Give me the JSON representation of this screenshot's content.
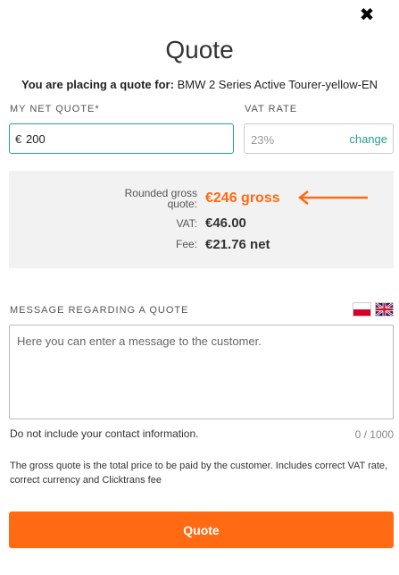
{
  "modal": {
    "title": "Quote",
    "close_icon": "close-icon",
    "subtitle_prefix": "You are placing a quote for:",
    "subtitle_product": "BMW 2 Series Active Tourer-yellow-EN"
  },
  "net_quote": {
    "label": "MY NET QUOTE*",
    "currency": "€",
    "value": "200"
  },
  "vat": {
    "label": "VAT RATE",
    "value": "23%",
    "change_label": "change"
  },
  "summary": {
    "gross_label": "Rounded gross quote:",
    "gross_value": "€246 gross",
    "vat_label": "VAT:",
    "vat_value": "€46.00",
    "fee_label": "Fee:",
    "fee_value": "€21.76 net",
    "accent_color": "#ff6a13"
  },
  "message": {
    "label": "MESSAGE REGARDING A QUOTE",
    "placeholder": "Here you can enter a message to the customer.",
    "hint": "Do not include your contact information.",
    "counter": "0 / 1000",
    "flags": [
      "flag-pl-icon",
      "flag-uk-icon"
    ]
  },
  "info_text": "The gross quote is the total price to be paid by the customer. Includes correct VAT rate, correct currency and Clicktrans fee",
  "submit_label": "Quote"
}
